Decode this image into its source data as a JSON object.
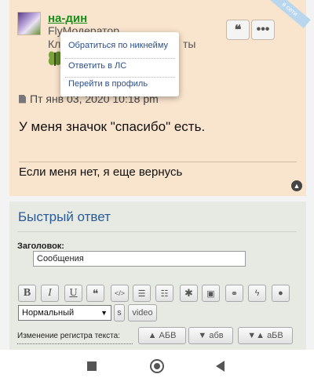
{
  "post": {
    "username": "на-дин",
    "user_role": "FlyМодератор",
    "user_title_start": "Кл",
    "user_title_end": "ты",
    "quote_icon": "❝",
    "more_icon": "•••",
    "online_badge": "в сети",
    "date": "Пт янв 03, 2020 10:18 pm",
    "text": "У меня значок \"спасибо\" есть.",
    "signature": "Если меня нет, я еще вернусь",
    "up_icon": "▲"
  },
  "context_menu": {
    "items": [
      {
        "label": "Обратиться по никнейму"
      },
      {
        "label": "Ответить в ЛС"
      },
      {
        "label": "Перейти в профиль"
      }
    ]
  },
  "quick_reply": {
    "title": "Быстрый ответ",
    "subject_label": "Заголовок:",
    "subject_value": "Сообщения",
    "toolbar": [
      {
        "name": "bold-button",
        "glyph": "B"
      },
      {
        "name": "italic-button",
        "glyph": "I"
      },
      {
        "name": "underline-button",
        "glyph": "U"
      },
      {
        "name": "quote-button",
        "glyph": "❝"
      },
      {
        "name": "code-button",
        "glyph": "</>"
      },
      {
        "name": "bullet-list-button",
        "glyph": "☰"
      },
      {
        "name": "numbered-list-button",
        "glyph": "☷"
      },
      {
        "name": "list-item-button",
        "glyph": "✱"
      },
      {
        "name": "image-button",
        "glyph": "▣"
      },
      {
        "name": "link-button",
        "glyph": "⚭"
      },
      {
        "name": "flash-button",
        "glyph": "ϟ"
      },
      {
        "name": "color-button",
        "glyph": "●"
      }
    ],
    "format_select": "Нормальный",
    "strike_label": "s",
    "video_label": "video",
    "case_label": "Изменение регистра текста:",
    "case_upper": "▲ АБВ",
    "case_lower": "▼ абв",
    "case_mixed": "▼▲ аБВ"
  },
  "colors": {
    "post_bg": "#f9e4cd",
    "reply_bg": "#e7eae2",
    "username": "#1a8d1a",
    "link_blue": "#2b5a9a"
  }
}
